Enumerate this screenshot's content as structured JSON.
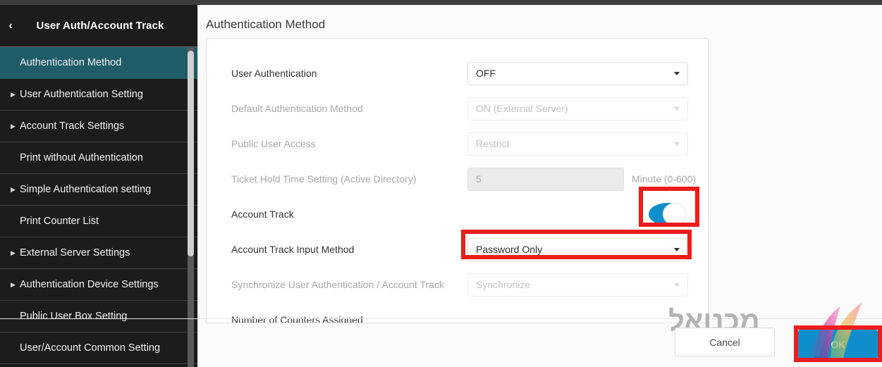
{
  "sidebar": {
    "back_icon": "chevron-left-icon",
    "title": "User Auth/Account Track",
    "items": [
      {
        "label": "Authentication Method",
        "expandable": false,
        "active": true
      },
      {
        "label": "User Authentication Setting",
        "expandable": true,
        "active": false
      },
      {
        "label": "Account Track Settings",
        "expandable": true,
        "active": false
      },
      {
        "label": "Print without Authentication",
        "expandable": false,
        "active": false
      },
      {
        "label": "Simple Authentication setting",
        "expandable": true,
        "active": false
      },
      {
        "label": "Print Counter List",
        "expandable": false,
        "active": false
      },
      {
        "label": "External Server Settings",
        "expandable": true,
        "active": false
      },
      {
        "label": "Authentication Device Settings",
        "expandable": true,
        "active": false
      },
      {
        "label": "Public User Box Setting",
        "expandable": false,
        "active": false
      },
      {
        "label": "User/Account Common Setting",
        "expandable": false,
        "active": false
      }
    ]
  },
  "main": {
    "page_title": "Authentication Method",
    "rows": [
      {
        "label": "User Authentication",
        "control": "select",
        "value": "OFF",
        "disabled": false
      },
      {
        "label": "Default Authentication Method",
        "control": "select",
        "value": "ON (External Server)",
        "disabled": true
      },
      {
        "label": "Public User Access",
        "control": "select",
        "value": "Restrict",
        "disabled": true
      },
      {
        "label": "Ticket Hold Time Setting (Active Directory)",
        "control": "textbox",
        "value": "5",
        "unit": "Minute (0-600)",
        "disabled": true
      },
      {
        "label": "Account Track",
        "control": "toggle",
        "value": "ON",
        "disabled": false
      },
      {
        "label": "Account Track Input Method",
        "control": "select",
        "value": "Password Only",
        "disabled": false
      },
      {
        "label": "Synchronize User Authentication / Account Track",
        "control": "select",
        "value": "Synchronize",
        "disabled": true
      },
      {
        "label": "Number of Counters Assigned",
        "control": "none",
        "value": "",
        "disabled": false
      }
    ]
  },
  "footer": {
    "cancel_label": "Cancel",
    "ok_label": "OK"
  },
  "overlay": {
    "watermark_text": "מכנואל",
    "highlight_color": "#ee1c1c",
    "accent_color": "#0e8fcc",
    "active_nav_color": "#1f5c68"
  }
}
